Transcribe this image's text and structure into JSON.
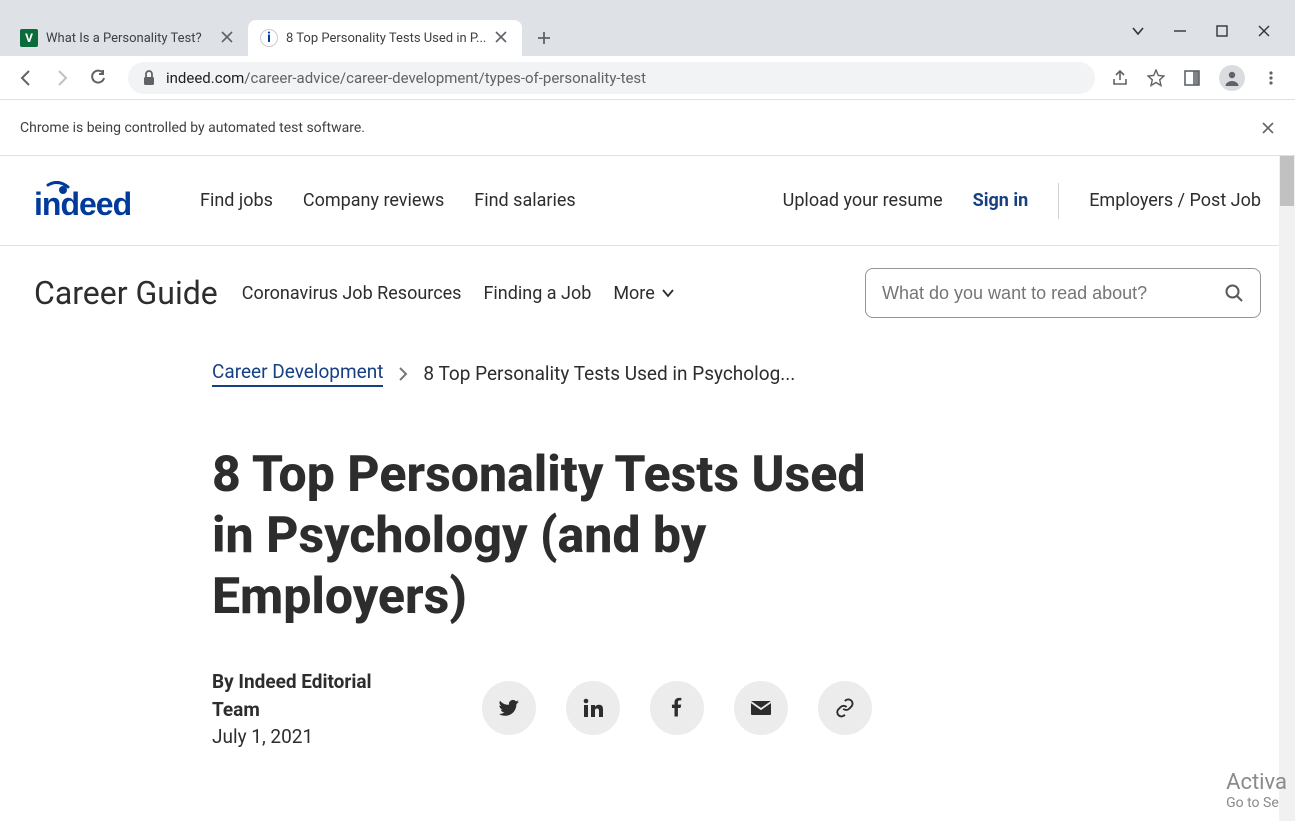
{
  "browser": {
    "tabs": [
      {
        "title": "What Is a Personality Test?",
        "favicon_letter": "V",
        "favicon_bg": "#0b6b3a",
        "active": false
      },
      {
        "title": "8 Top Personality Tests Used in P...",
        "favicon_letter": "i",
        "favicon_bg": "#ffffff",
        "favicon_fg": "#003a9b",
        "active": true
      }
    ],
    "url_domain": "indeed.com",
    "url_path": "/career-advice/career-development/types-of-personality-test",
    "infobar_text": "Chrome is being controlled by automated test software."
  },
  "site_header": {
    "logo_text": "indeed",
    "nav": [
      "Find jobs",
      "Company reviews",
      "Find salaries"
    ],
    "upload_label": "Upload your resume",
    "signin_label": "Sign in",
    "employers_label": "Employers / Post Job"
  },
  "subnav": {
    "title": "Career Guide",
    "links": [
      "Coronavirus Job Resources",
      "Finding a Job"
    ],
    "more_label": "More",
    "search_placeholder": "What do you want to read about?"
  },
  "article": {
    "breadcrumb_parent": "Career Development",
    "breadcrumb_current": "8 Top Personality Tests Used in Psycholog...",
    "title": "8 Top Personality Tests Used in Psychology (and by Employers)",
    "author_line": "By Indeed Editorial Team",
    "date": "July 1, 2021"
  },
  "watermark": {
    "line1": "Activa",
    "line2": "Go to Se"
  }
}
